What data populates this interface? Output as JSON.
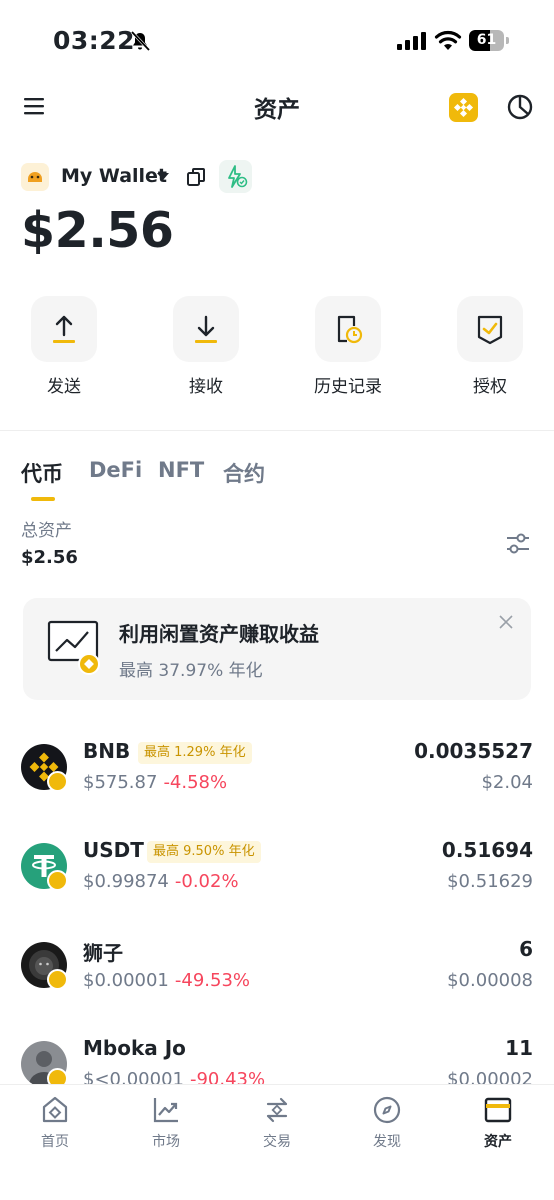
{
  "status_bar": {
    "time": "03:22",
    "battery": "61",
    "battery_level": 0.61
  },
  "header": {
    "title": "资产"
  },
  "wallet": {
    "name": "My Wallet",
    "balance": "$2.56"
  },
  "actions": [
    {
      "label": "发送",
      "icon": "upload-icon"
    },
    {
      "label": "接收",
      "icon": "download-icon"
    },
    {
      "label": "历史记录",
      "icon": "history-icon"
    },
    {
      "label": "授权",
      "icon": "authorize-icon"
    }
  ],
  "tabs": [
    {
      "label": "代币",
      "active": true
    },
    {
      "label": "DeFi",
      "active": false
    },
    {
      "label": "NFT",
      "active": false
    },
    {
      "label": "合约",
      "active": false
    }
  ],
  "total": {
    "label": "总资产",
    "value": "$2.56"
  },
  "earn_banner": {
    "title": "利用闲置资产赚取收益",
    "subtitle": "最高 37.97% 年化"
  },
  "assets": [
    {
      "name": "BNB",
      "apr_tag": "最高 1.29% 年化",
      "price": "$575.87",
      "change": "-4.58%",
      "amount": "0.0035527",
      "value": "$2.04"
    },
    {
      "name": "USDT",
      "apr_tag": "最高 9.50% 年化",
      "price": "$0.99874",
      "change": "-0.02%",
      "amount": "0.51694",
      "value": "$0.51629"
    },
    {
      "name": "狮子",
      "apr_tag": "",
      "price": "$0.00001",
      "change": "-49.53%",
      "amount": "6",
      "value": "$0.00008"
    },
    {
      "name": "Mboka Jo",
      "apr_tag": "",
      "price": "$<0.00001",
      "change": "-90.43%",
      "amount": "11",
      "value": "$0.00002"
    }
  ],
  "bottom_nav": [
    {
      "label": "首页",
      "icon": "home-icon",
      "active": false
    },
    {
      "label": "市场",
      "icon": "market-icon",
      "active": false
    },
    {
      "label": "交易",
      "icon": "trade-icon",
      "active": false
    },
    {
      "label": "发现",
      "icon": "discover-icon",
      "active": false
    },
    {
      "label": "资产",
      "icon": "assets-icon",
      "active": true
    }
  ],
  "colors": {
    "accent": "#f0b90b",
    "negative": "#f6465d",
    "secondary_text": "#707a8a"
  }
}
